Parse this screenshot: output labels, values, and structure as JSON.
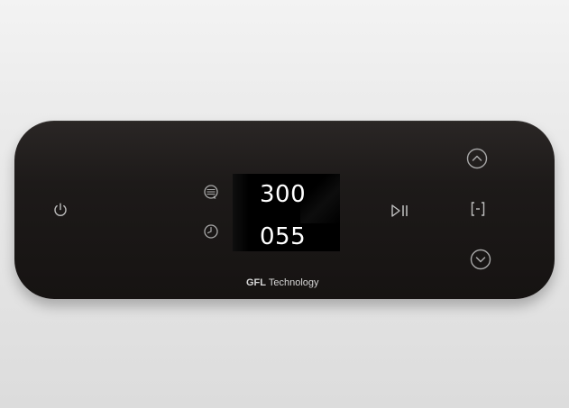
{
  "panel": {
    "display": {
      "power_value": "300",
      "time_value": "055"
    },
    "brand": {
      "bold": "GFL",
      "rest": " Technology"
    },
    "icons": {
      "power": "power-icon",
      "power_setting": "power-setting-icon",
      "timer": "clock-icon",
      "start_pause": "play-pause-icon",
      "up": "chevron-up-icon",
      "mode": "bracket-minus-icon",
      "down": "chevron-down-icon"
    }
  }
}
